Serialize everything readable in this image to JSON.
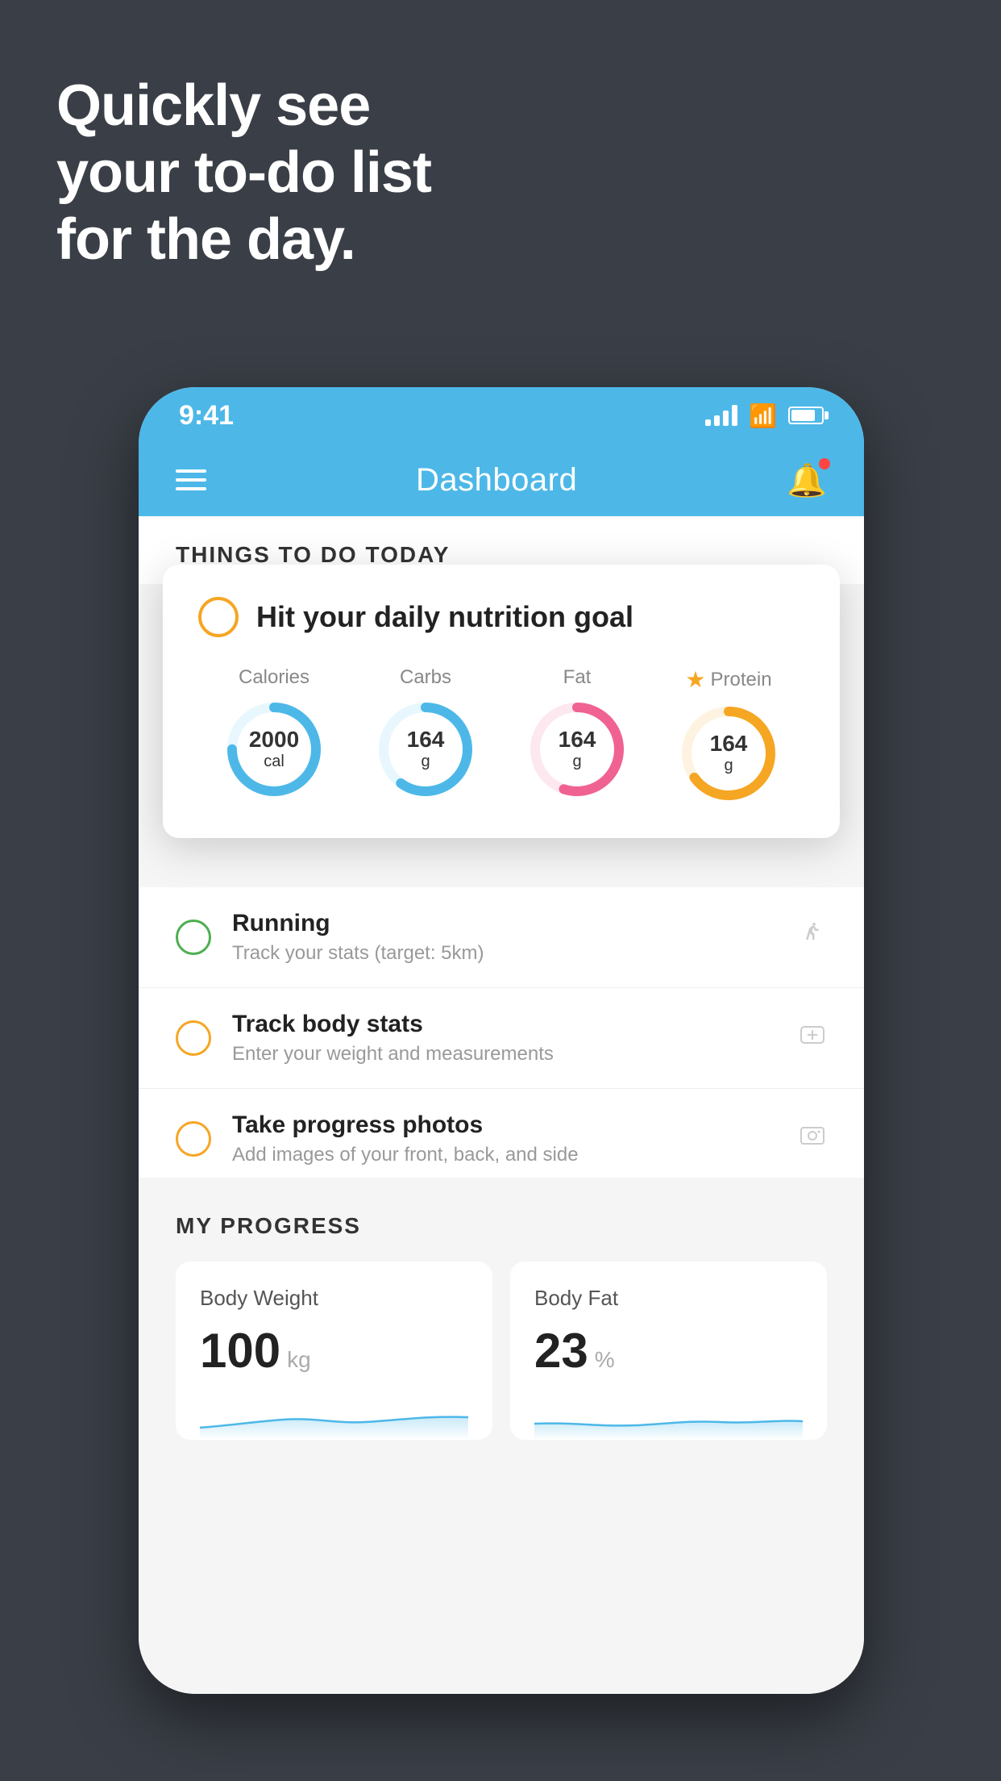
{
  "hero": {
    "line1": "Quickly see",
    "line2": "your to-do list",
    "line3": "for the day."
  },
  "phone": {
    "status": {
      "time": "9:41"
    },
    "header": {
      "title": "Dashboard"
    },
    "section": {
      "title": "THINGS TO DO TODAY"
    },
    "floating_card": {
      "title": "Hit your daily nutrition goal",
      "nutrition": [
        {
          "label": "Calories",
          "value": "2000",
          "unit": "cal",
          "color": "#4db8e8",
          "track": 75,
          "starred": false
        },
        {
          "label": "Carbs",
          "value": "164",
          "unit": "g",
          "color": "#4db8e8",
          "track": 60,
          "starred": false
        },
        {
          "label": "Fat",
          "value": "164",
          "unit": "g",
          "color": "#f06292",
          "track": 55,
          "starred": false
        },
        {
          "label": "Protein",
          "value": "164",
          "unit": "g",
          "color": "#f5a623",
          "track": 65,
          "starred": true
        }
      ]
    },
    "todo_items": [
      {
        "title": "Running",
        "subtitle": "Track your stats (target: 5km)",
        "circle_color": "green",
        "icon": "👟"
      },
      {
        "title": "Track body stats",
        "subtitle": "Enter your weight and measurements",
        "circle_color": "yellow",
        "icon": "⚖️"
      },
      {
        "title": "Take progress photos",
        "subtitle": "Add images of your front, back, and side",
        "circle_color": "yellow",
        "icon": "🖼️"
      }
    ],
    "progress": {
      "section_title": "MY PROGRESS",
      "cards": [
        {
          "title": "Body Weight",
          "value": "100",
          "unit": "kg"
        },
        {
          "title": "Body Fat",
          "value": "23",
          "unit": "%"
        }
      ]
    }
  }
}
